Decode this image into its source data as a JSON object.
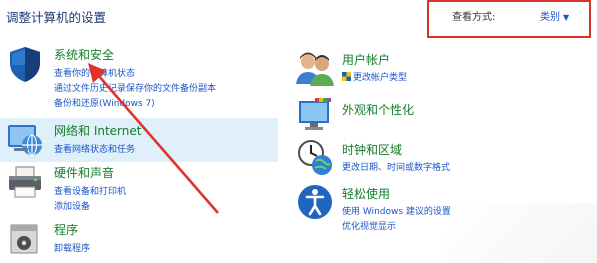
{
  "header": {
    "title": "调整计算机的设置",
    "view_by_label": "查看方式:",
    "view_by_value": "类别"
  },
  "left_categories": [
    {
      "title": "系统和安全",
      "links": [
        "查看你的计算机状态",
        "通过文件历史记录保存你的文件备份副本",
        "备份和还原(Windows 7)"
      ]
    },
    {
      "title": "网络和 Internet",
      "links": [
        "查看网络状态和任务"
      ]
    },
    {
      "title": "硬件和声音",
      "links": [
        "查看设备和打印机",
        "添加设备"
      ]
    },
    {
      "title": "程序",
      "links": [
        "卸载程序"
      ]
    }
  ],
  "right_categories": [
    {
      "title": "用户帐户",
      "links": [
        "更改帐户类型"
      ]
    },
    {
      "title": "外观和个性化",
      "links": []
    },
    {
      "title": "时钟和区域",
      "links": [
        "更改日期、时间或数字格式"
      ]
    },
    {
      "title": "轻松使用",
      "links": [
        "使用 Windows 建议的设置",
        "优化视觉显示"
      ]
    }
  ],
  "colors": {
    "title_green": "#157d2a",
    "link_blue": "#1a55c8",
    "highlight_box": "#d9342b",
    "arrow": "#e0342b",
    "row_highlight": "#dff0fb"
  }
}
